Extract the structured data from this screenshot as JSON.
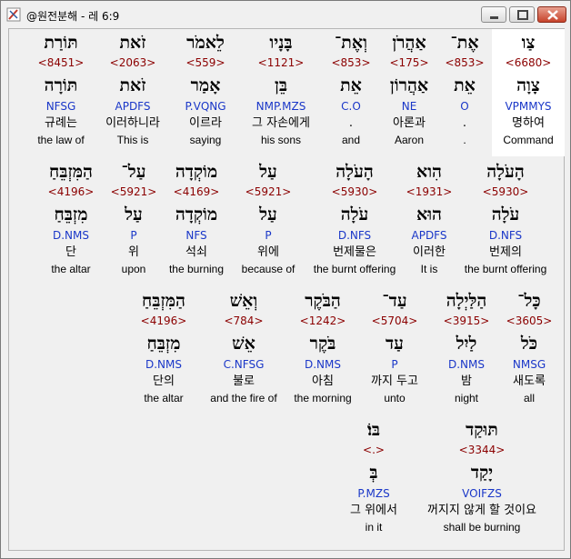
{
  "window": {
    "title": "@원전분해 - 레 6:9"
  },
  "words": [
    {
      "h1": "צַו",
      "num": "<6680>",
      "h2": "צָוָה",
      "parse": "VPMMYS",
      "kor": "명하여",
      "eng": "Command"
    },
    {
      "h1": "אֶת־",
      "num": "<853>",
      "h2": "אֵת",
      "parse": "O",
      "kor": ".",
      "eng": "."
    },
    {
      "h1": "אַהֲרֹן",
      "num": "<175>",
      "h2": "אַהֲרוֹן",
      "parse": "NE",
      "kor": "아론과",
      "eng": "Aaron"
    },
    {
      "h1": "וְאֶת־",
      "num": "<853>",
      "h2": "אֵת",
      "parse": "C.O",
      "kor": ".",
      "eng": "and"
    },
    {
      "h1": "בָּנָיו",
      "num": "<1121>",
      "h2": "בֵּן",
      "parse": "NMP.MZS",
      "kor": "그 자손에게",
      "eng": "his sons"
    },
    {
      "h1": "לֵאמֹר",
      "num": "<559>",
      "h2": "אָמַר",
      "parse": "P.VQNG",
      "kor": "이르라",
      "eng": "saying"
    },
    {
      "h1": "זֹאת",
      "num": "<2063>",
      "h2": "זֹאת",
      "parse": "APDFS",
      "kor": "이러하니라",
      "eng": "This is"
    },
    {
      "h1": "תּוֹרַת",
      "num": "<8451>",
      "h2": "תּוֹרָה",
      "parse": "NFSG",
      "kor": "규례는",
      "eng": "the law of"
    },
    {
      "h1": "הָעֹלָה",
      "num": "<5930>",
      "h2": "עֹלָה",
      "parse": "D.NFS",
      "kor": "번제의",
      "eng": "the burnt offering"
    },
    {
      "h1": "הִוא",
      "num": "<1931>",
      "h2": "הוּא",
      "parse": "APDFS",
      "kor": "이러한",
      "eng": "It is"
    },
    {
      "h1": "הָעֹלָה",
      "num": "<5930>",
      "h2": "עֹלָה",
      "parse": "D.NFS",
      "kor": "번제물은",
      "eng": "the burnt offering"
    },
    {
      "h1": "עַל",
      "num": "<5921>",
      "h2": "עַל",
      "parse": "P",
      "kor": "위에",
      "eng": "because of"
    },
    {
      "h1": "מוֹקְדָה",
      "num": "<4169>",
      "h2": "מוֹקְדָה",
      "parse": "NFS",
      "kor": "석쇠",
      "eng": "the burning"
    },
    {
      "h1": "עַל־",
      "num": "<5921>",
      "h2": "עַל",
      "parse": "P",
      "kor": "위",
      "eng": "upon"
    },
    {
      "h1": "הַמִּזְבֵּחַ",
      "num": "<4196>",
      "h2": "מִזְבֵּחַ",
      "parse": "D.NMS",
      "kor": "단",
      "eng": "the altar"
    },
    {
      "h1": "כָּל־",
      "num": "<3605>",
      "h2": "כֹּל",
      "parse": "NMSG",
      "kor": "새도록",
      "eng": "all"
    },
    {
      "h1": "הַלַּיְלָה",
      "num": "<3915>",
      "h2": "לַיִל",
      "parse": "D.NMS",
      "kor": "밤",
      "eng": "night"
    },
    {
      "h1": "עַד־",
      "num": "<5704>",
      "h2": "עַד",
      "parse": "P",
      "kor": "까지 두고",
      "eng": "unto"
    },
    {
      "h1": "הַבֹּקֶר",
      "num": "<1242>",
      "h2": "בֹּקֶר",
      "parse": "D.NMS",
      "kor": "아침",
      "eng": "the morning"
    },
    {
      "h1": "וְאֵשׁ",
      "num": "<784>",
      "h2": "אֵשׁ",
      "parse": "C.NFSG",
      "kor": "불로",
      "eng": "and the fire of"
    },
    {
      "h1": "הַמִּזְבֵּחַ",
      "num": "<4196>",
      "h2": "מִזְבֵּחַ",
      "parse": "D.NMS",
      "kor": "단의",
      "eng": "the altar"
    },
    {
      "h1": "תּוּקַד",
      "num": "<3344>",
      "h2": "יָקַד",
      "parse": "VOIFZS",
      "kor": "꺼지지 않게 할 것이요",
      "eng": "shall be burning"
    },
    {
      "h1": "בּוֹ׃",
      "num": "<.>",
      "h2": "בְּ",
      "parse": "P.MZS",
      "kor": "그 위에서",
      "eng": "in it"
    }
  ]
}
